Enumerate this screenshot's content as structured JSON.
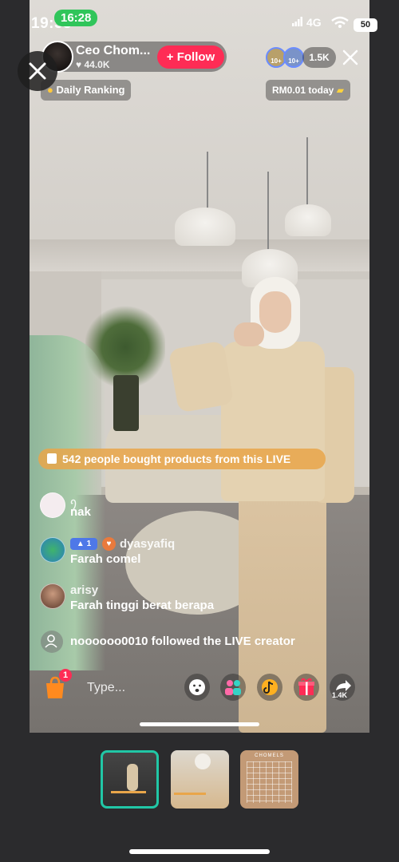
{
  "status_bar": {
    "time": "19:55",
    "call_time": "16:28",
    "network": "4G",
    "battery": "50"
  },
  "creator": {
    "name": "Ceo Chom...",
    "likes": "44.0K",
    "follow_label": "+ Follow",
    "viewer_badges": [
      "10+",
      "10+"
    ],
    "viewer_count": "1.5K"
  },
  "chips": {
    "ranking": "Daily Ranking",
    "earnings": "RM0.01 today"
  },
  "banner": {
    "bought": "542 people bought products from this LIVE"
  },
  "comments": [
    {
      "user": "ꪆ",
      "text": "nak"
    },
    {
      "level": "1",
      "user": "dyasyafiq",
      "text": "Farah comel"
    },
    {
      "user": "arisy",
      "text": "Farah tinggi berat berapa"
    }
  ],
  "system_message": {
    "text": "noooooo0010 followed the LIVE creator"
  },
  "bottom_bar": {
    "cart_count": "1",
    "input_placeholder": "Type...",
    "share_count": "1.4K"
  },
  "icons": {
    "bag": "shopping-bag-icon",
    "emoji": "emoji-icon",
    "guests": "multi-guest-icon",
    "gift_accent": "#fe2c55",
    "accent_follow": "#fe2c55",
    "accent_selected": "#21c7a6"
  },
  "thumbnails": {
    "third_caption": "CHOMELS"
  }
}
